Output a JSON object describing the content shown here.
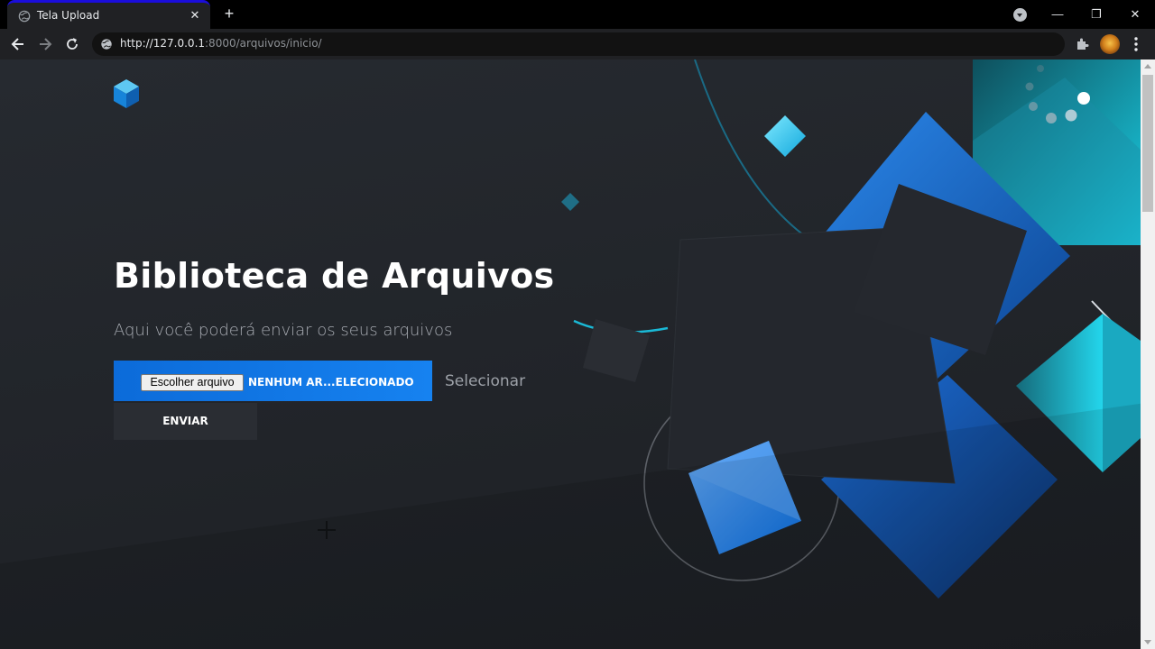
{
  "browser": {
    "tab_title": "Tela Upload",
    "tab_close": "✕",
    "new_tab": "+",
    "url_host": "http://127.0.0.1",
    "url_path": ":8000/arquivos/inicio/",
    "window_controls": {
      "minimize": "—",
      "restore": "❐",
      "close": "✕"
    }
  },
  "page": {
    "title": "Biblioteca de Arquivos",
    "subtitle": "Aqui você poderá enviar os seus arquivos",
    "upload": {
      "choose_button": "Escolher arquivo",
      "file_name": "NENHUM AR...ELECIONADO",
      "select_label": "Selecionar"
    },
    "send_button": "ENVIAR"
  },
  "colors": {
    "accent_blue": "#1682f0",
    "page_bg": "#22252a",
    "teal": "#1ecbe1"
  }
}
